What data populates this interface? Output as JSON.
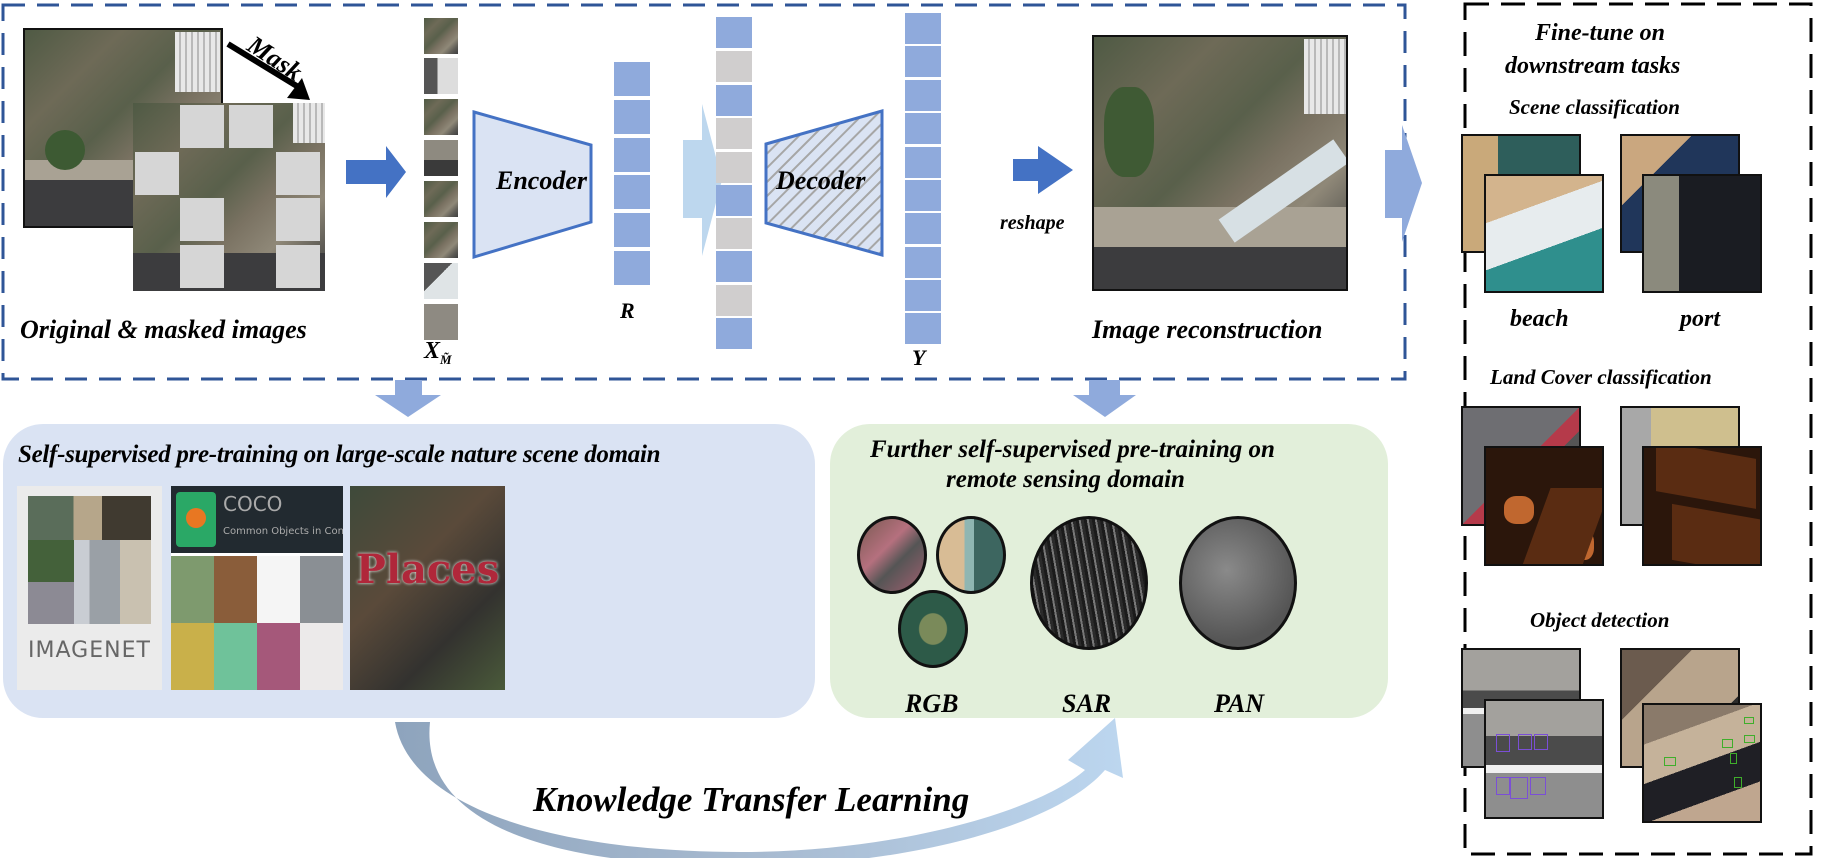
{
  "pretrain_pipeline": {
    "mask_label": "Mask",
    "original_masked_caption": "Original & masked images",
    "visible_patches_label": "X",
    "visible_patches_subscript": "M̃",
    "encoder_label": "Encoder",
    "latent_label": "R",
    "decoder_label": "Decoder",
    "output_label": "Y",
    "reshape_label": "reshape",
    "reconstruction_caption": "Image reconstruction",
    "latent_tokens": [
      "visible",
      "visible",
      "visible",
      "visible",
      "visible",
      "visible"
    ],
    "decoder_input_tokens": [
      "visible",
      "mask",
      "visible",
      "mask",
      "mask",
      "visible",
      "mask",
      "visible",
      "mask",
      "visible"
    ],
    "output_tokens": 10
  },
  "nature_domain": {
    "title": "Self-supervised pre-training on large-scale nature scene domain",
    "datasets": [
      {
        "name": "ImageNet",
        "logo_text": "IMAGENET"
      },
      {
        "name": "COCO",
        "logo_text": "COCO",
        "subtitle": "Common Objects in Context"
      },
      {
        "name": "Places",
        "logo_text": "Places"
      }
    ]
  },
  "remote_sensing_domain": {
    "title_line1": "Further self-supervised pre-training on",
    "title_line2": "remote sensing domain",
    "modalities": [
      "RGB",
      "SAR",
      "PAN"
    ]
  },
  "transfer_label": "Knowledge Transfer Learning",
  "downstream": {
    "title_line1": "Fine-tune on",
    "title_line2": "downstream tasks",
    "tasks": [
      {
        "name": "Scene classification",
        "examples": [
          "beach",
          "port"
        ]
      },
      {
        "name": "Land Cover classification",
        "examples": []
      },
      {
        "name": "Object detection",
        "examples": []
      }
    ]
  },
  "colors": {
    "dashed_border": "#2f5597",
    "token_blue": "#8faadc",
    "token_gray": "#d0cece",
    "arrow_blue": "#4472c4",
    "arrow_light": "#b4d0ec",
    "encoder_fill": "#dae3f3",
    "nature_box": "#dae3f3",
    "remote_box": "#e2efda"
  }
}
